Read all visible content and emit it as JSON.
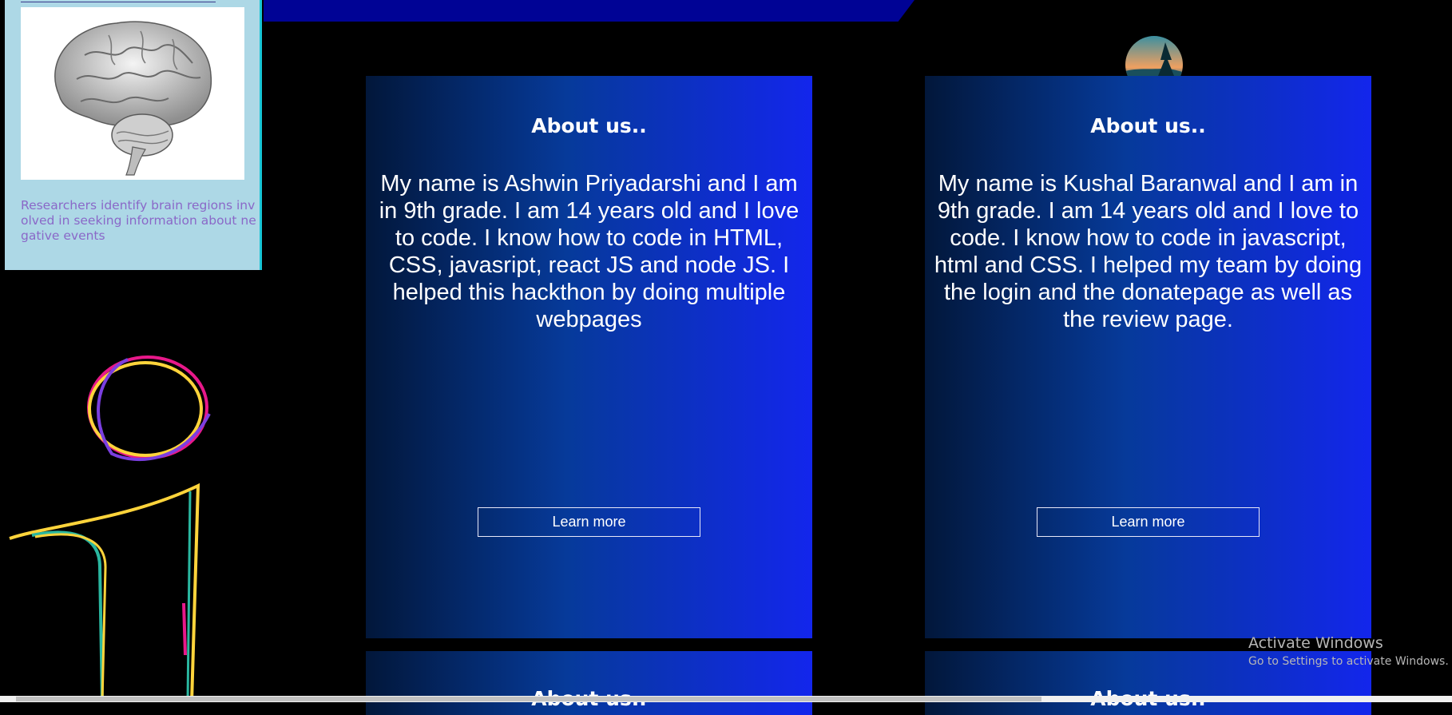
{
  "news": {
    "caption": "Researchers identify brain regions involved in seeking information about negative events",
    "image_icon": "brain-icon"
  },
  "cards": [
    {
      "title": "About us..",
      "text": "My name is Ashwin Priyadarshi and I am in 9th grade. I am 14 years old and I love to code. I know how to code in HTML, CSS, javasript, react JS and node JS. I helped this hackthon by doing multiple webpages",
      "button": "Learn more"
    },
    {
      "title": "About us..",
      "text": "My name is Kushal Baranwal and I am in 9th grade. I am 14 years old and I love to code. I know how to code in javascript, html and CSS. I helped my team by doing the login and the donatepage as well as the review page.",
      "button": "Learn more"
    },
    {
      "title": "About us.."
    },
    {
      "title": "About us.."
    }
  ],
  "watermark": {
    "title": "Activate Windows",
    "subtitle": "Go to Settings to activate Windows."
  },
  "colors": {
    "banner": "#000395",
    "news_bg": "#add8e6",
    "card_gradient_start": "#02173a",
    "card_gradient_end": "#1326ec",
    "caption": "#8a68c8"
  }
}
